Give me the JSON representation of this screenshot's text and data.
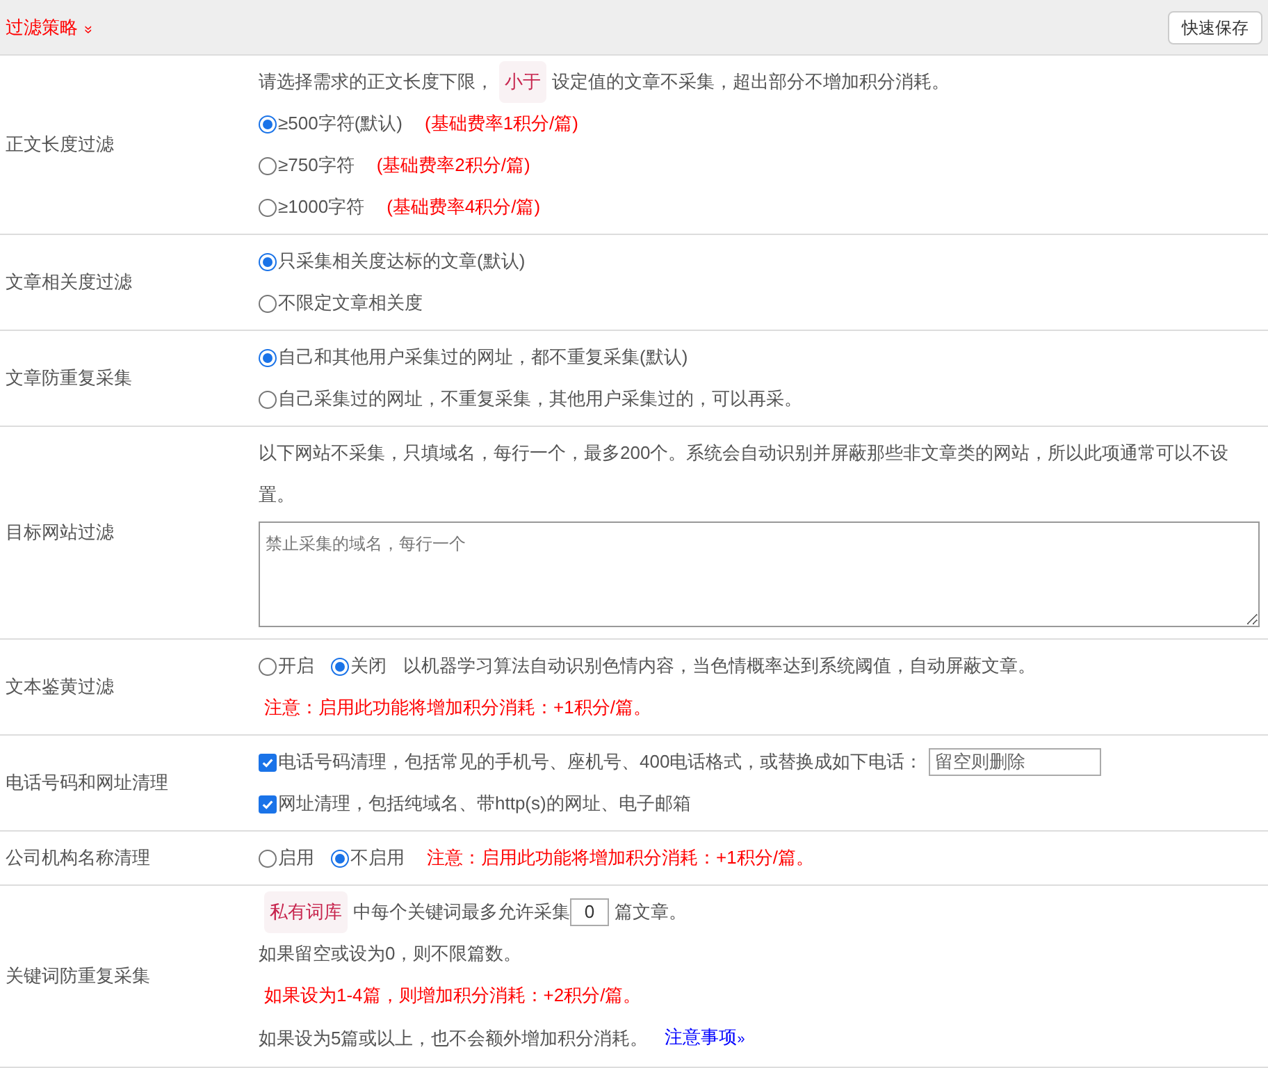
{
  "header": {
    "title": "过滤策略",
    "toggle": "»",
    "save_button": "快速保存"
  },
  "rows": [
    {
      "label": "正文长度过滤",
      "lines": [
        [
          {
            "kind": "text",
            "text": "请选择需求的正文长度下限，"
          },
          {
            "kind": "tag",
            "text": "小于"
          },
          {
            "kind": "text",
            "text": "设定值的文章不采集，超出部分不增加积分消耗。"
          }
        ],
        [
          {
            "kind": "radio",
            "text": "≥500字符(默认)",
            "selected": true
          },
          {
            "kind": "red",
            "text": "(基础费率1积分/篇)"
          }
        ],
        [
          {
            "kind": "radio",
            "text": "≥750字符",
            "selected": false
          },
          {
            "kind": "red",
            "text": "(基础费率2积分/篇)"
          }
        ],
        [
          {
            "kind": "radio",
            "text": "≥1000字符",
            "selected": false
          },
          {
            "kind": "red",
            "text": "(基础费率4积分/篇)"
          }
        ]
      ]
    },
    {
      "label": "文章相关度过滤",
      "lines": [
        [
          {
            "kind": "radio",
            "text": "只采集相关度达标的文章(默认)",
            "selected": true
          }
        ],
        [
          {
            "kind": "radio",
            "text": "不限定文章相关度",
            "selected": false
          }
        ]
      ]
    },
    {
      "label": "文章防重复采集",
      "lines": [
        [
          {
            "kind": "radio",
            "text": "自己和其他用户采集过的网址，都不重复采集(默认)",
            "selected": true
          }
        ],
        [
          {
            "kind": "radio",
            "text": "自己采集过的网址，不重复采集，其他用户采集过的，可以再采。",
            "selected": false
          }
        ]
      ]
    },
    {
      "label": "目标网站过滤",
      "lines": [
        [
          {
            "kind": "text",
            "text": "以下网站不采集，只填域名，每行一个，最多200个。系统会自动识别并屏蔽那些非文章类的网站，所以此项通常可以不设置。"
          }
        ],
        [
          {
            "kind": "textarea",
            "placeholder": "禁止采集的域名，每行一个"
          }
        ]
      ]
    },
    {
      "label": "文本鉴黄过滤",
      "lines": [
        [
          {
            "kind": "radio",
            "text": "开启",
            "selected": false
          },
          {
            "kind": "radio",
            "text": "关闭",
            "selected": true
          },
          {
            "kind": "text",
            "text": "以机器学习算法自动识别色情内容，当色情概率达到系统阈值，自动屏蔽文章。"
          }
        ],
        [
          {
            "kind": "red",
            "text": "注意：启用此功能将增加积分消耗：+1积分/篇。"
          }
        ]
      ]
    },
    {
      "label": "电话号码和网址清理",
      "lines": [
        [
          {
            "kind": "checkbox",
            "text": "电话号码清理，包括常见的手机号、座机号、400电话格式，或替换成如下电话：",
            "checked": true
          },
          {
            "kind": "input",
            "placeholder": "留空则删除"
          }
        ],
        [
          {
            "kind": "checkbox",
            "text": "网址清理，包括纯域名、带http(s)的网址、电子邮箱",
            "checked": true
          }
        ]
      ]
    },
    {
      "label": "公司机构名称清理",
      "lines": [
        [
          {
            "kind": "radio",
            "text": "启用",
            "selected": false
          },
          {
            "kind": "radio",
            "text": "不启用",
            "selected": true
          },
          {
            "kind": "red",
            "text": "注意：启用此功能将增加积分消耗：+1积分/篇。"
          }
        ]
      ]
    },
    {
      "label": "关键词防重复采集",
      "lines": [
        [
          {
            "kind": "tag",
            "text": "私有词库"
          },
          {
            "kind": "text",
            "text": "中每个关键词最多允许采集"
          },
          {
            "kind": "number",
            "value": "0"
          },
          {
            "kind": "text",
            "text": "篇文章。"
          }
        ],
        [
          {
            "kind": "text",
            "text": "如果留空或设为0，则不限篇数。"
          }
        ],
        [
          {
            "kind": "red",
            "text": "如果设为1-4篇，则增加积分消耗：+2积分/篇。"
          }
        ],
        [
          {
            "kind": "text",
            "text": "如果设为5篇或以上，也不会额外增加积分消耗。"
          },
          {
            "kind": "link",
            "text": "注意事项",
            "toggle": "»"
          }
        ]
      ]
    }
  ]
}
